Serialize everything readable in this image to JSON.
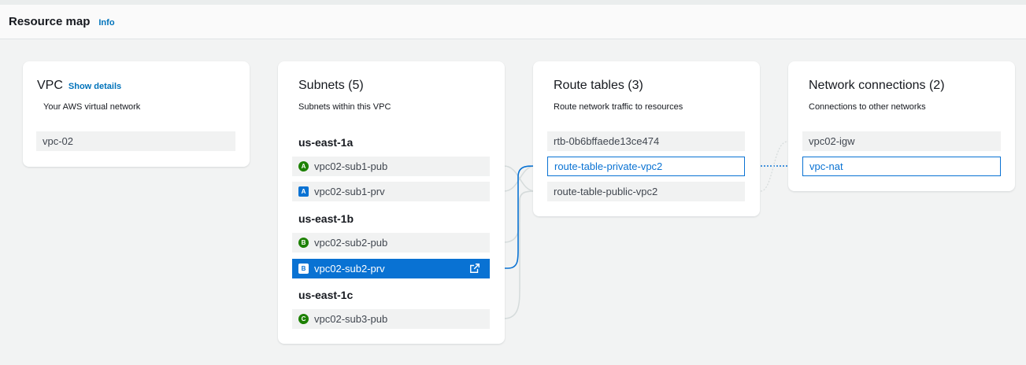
{
  "header": {
    "title": "Resource map",
    "info_label": "Info"
  },
  "vpc": {
    "title": "VPC",
    "show_details": "Show details",
    "subtitle": "Your AWS virtual network",
    "item": "vpc-02"
  },
  "subnets": {
    "title": "Subnets (5)",
    "subtitle": "Subnets within this VPC",
    "zones": [
      {
        "name": "us-east-1a"
      },
      {
        "name": "us-east-1b"
      },
      {
        "name": "us-east-1c"
      }
    ],
    "items": [
      {
        "badge": "A",
        "name": "vpc02-sub1-pub",
        "type": "public"
      },
      {
        "badge": "A",
        "name": "vpc02-sub1-prv",
        "type": "private"
      },
      {
        "badge": "B",
        "name": "vpc02-sub2-pub",
        "type": "public"
      },
      {
        "badge": "B",
        "name": "vpc02-sub2-prv",
        "type": "private",
        "selected": true
      },
      {
        "badge": "C",
        "name": "vpc02-sub3-pub",
        "type": "public"
      }
    ]
  },
  "route_tables": {
    "title": "Route tables (3)",
    "subtitle": "Route network traffic to resources",
    "items": [
      {
        "name": "rtb-0b6bffaede13ce474"
      },
      {
        "name": "route-table-private-vpc2",
        "highlighted": true
      },
      {
        "name": "route-table-public-vpc2"
      }
    ]
  },
  "network_connections": {
    "title": "Network connections (2)",
    "subtitle": "Connections to other networks",
    "items": [
      {
        "name": "vpc02-igw"
      },
      {
        "name": "vpc-nat",
        "highlighted": true
      }
    ]
  },
  "colors": {
    "accent": "#0972d3",
    "public_badge": "#1d8102",
    "connector": "#d5dbdb",
    "background": "#f2f3f3"
  },
  "icons": {
    "external_link": "external-link-icon"
  }
}
